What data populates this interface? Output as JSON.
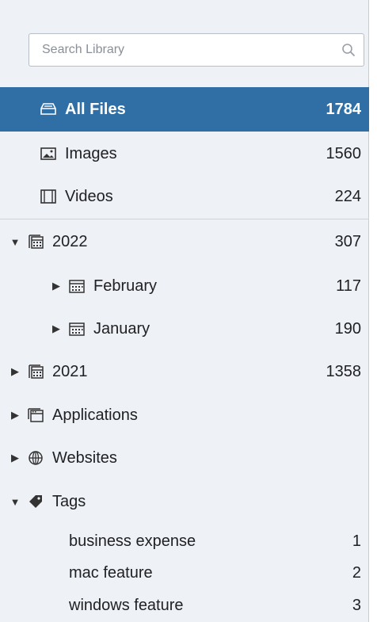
{
  "search": {
    "placeholder": "Search Library"
  },
  "library": [
    {
      "label": "All Files",
      "count": "1784"
    },
    {
      "label": "Images",
      "count": "1560"
    },
    {
      "label": "Videos",
      "count": "224"
    }
  ],
  "years": [
    {
      "label": "2022",
      "count": "307",
      "expanded": true,
      "months": [
        {
          "label": "February",
          "count": "117"
        },
        {
          "label": "January",
          "count": "190"
        }
      ]
    },
    {
      "label": "2021",
      "count": "1358",
      "expanded": false
    }
  ],
  "applications": {
    "label": "Applications"
  },
  "websites": {
    "label": "Websites"
  },
  "tags": {
    "label": "Tags",
    "items": [
      {
        "label": "business expense",
        "count": "1"
      },
      {
        "label": "mac feature",
        "count": "2"
      },
      {
        "label": "windows feature",
        "count": "3"
      }
    ]
  },
  "colors": {
    "selected": "#2f6fa6",
    "panel": "#eef1f5"
  }
}
